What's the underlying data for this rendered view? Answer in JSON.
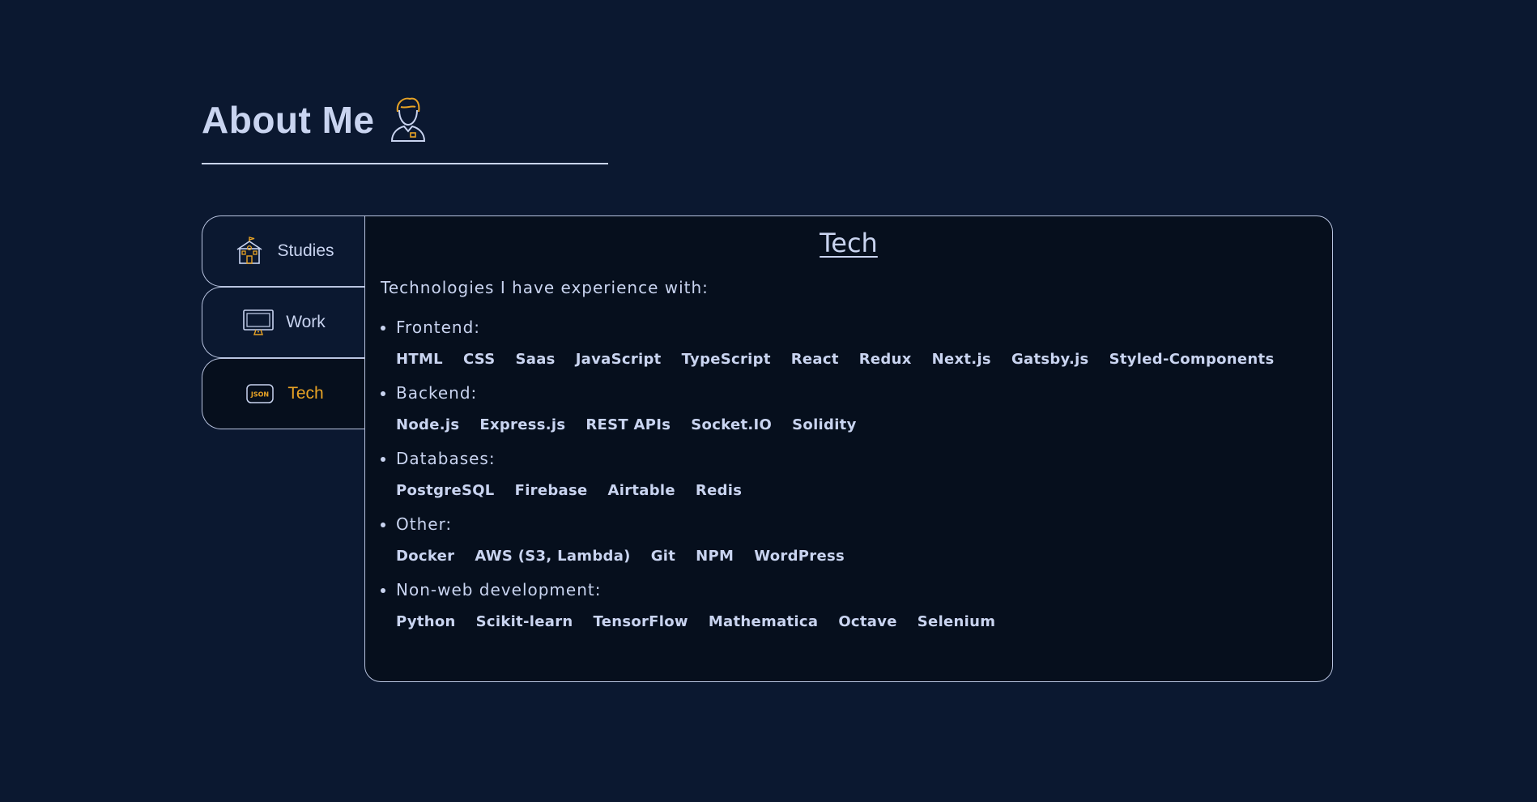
{
  "header": {
    "title": "About Me",
    "avatar_icon": "person-avatar-icon"
  },
  "tabs": [
    {
      "label": "Studies",
      "icon": "school-icon",
      "active": false
    },
    {
      "label": "Work",
      "icon": "monitor-icon",
      "active": false
    },
    {
      "label": "Tech",
      "icon": "json-icon",
      "active": true
    }
  ],
  "panel": {
    "title": "Tech",
    "intro": "Technologies I have experience with:",
    "groups": [
      {
        "label": "Frontend:",
        "items": [
          "HTML",
          "CSS",
          "Saas",
          "JavaScript",
          "TypeScript",
          "React",
          "Redux",
          "Next.js",
          "Gatsby.js",
          "Styled-Components"
        ]
      },
      {
        "label": "Backend:",
        "items": [
          "Node.js",
          "Express.js",
          "REST APIs",
          "Socket.IO",
          "Solidity"
        ]
      },
      {
        "label": "Databases:",
        "items": [
          "PostgreSQL",
          "Firebase",
          "Airtable",
          "Redis"
        ]
      },
      {
        "label": "Other:",
        "items": [
          "Docker",
          "AWS (S3, Lambda)",
          "Git",
          "NPM",
          "WordPress"
        ]
      },
      {
        "label": "Non-web development:",
        "items": [
          "Python",
          "Scikit-learn",
          "TensorFlow",
          "Mathematica",
          "Octave",
          "Selenium"
        ]
      }
    ]
  },
  "colors": {
    "background": "#0b1830",
    "panel": "#060f1d",
    "text": "#c9d4f0",
    "accent": "#e8a325"
  }
}
